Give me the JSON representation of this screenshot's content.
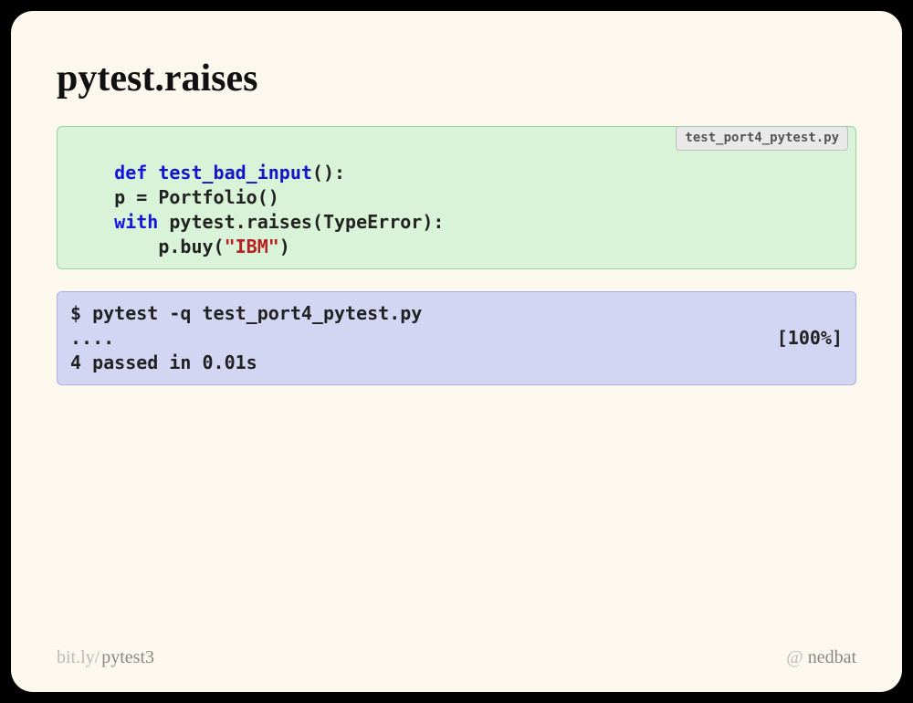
{
  "title": "pytest.raises",
  "code1": {
    "filename": "test_port4_pytest.py",
    "tokens": {
      "def": "def",
      "fname": "test_bad_input",
      "l1_tail": "():",
      "l2": "    p = Portfolio()",
      "with": "with",
      "l3_mid": " pytest.raises(TypeError):",
      "l4_pre": "        p.buy(",
      "str": "\"IBM\"",
      "l4_post": ")"
    }
  },
  "code2": {
    "l1": "$ pytest -q test_port4_pytest.py",
    "l2_left": "....",
    "l2_right": "[100%]",
    "l3": "4 passed in 0.01s"
  },
  "footer": {
    "link_prefix": "bit.ly/",
    "link_slug": "pytest3",
    "at": "@",
    "handle": "nedbat"
  }
}
